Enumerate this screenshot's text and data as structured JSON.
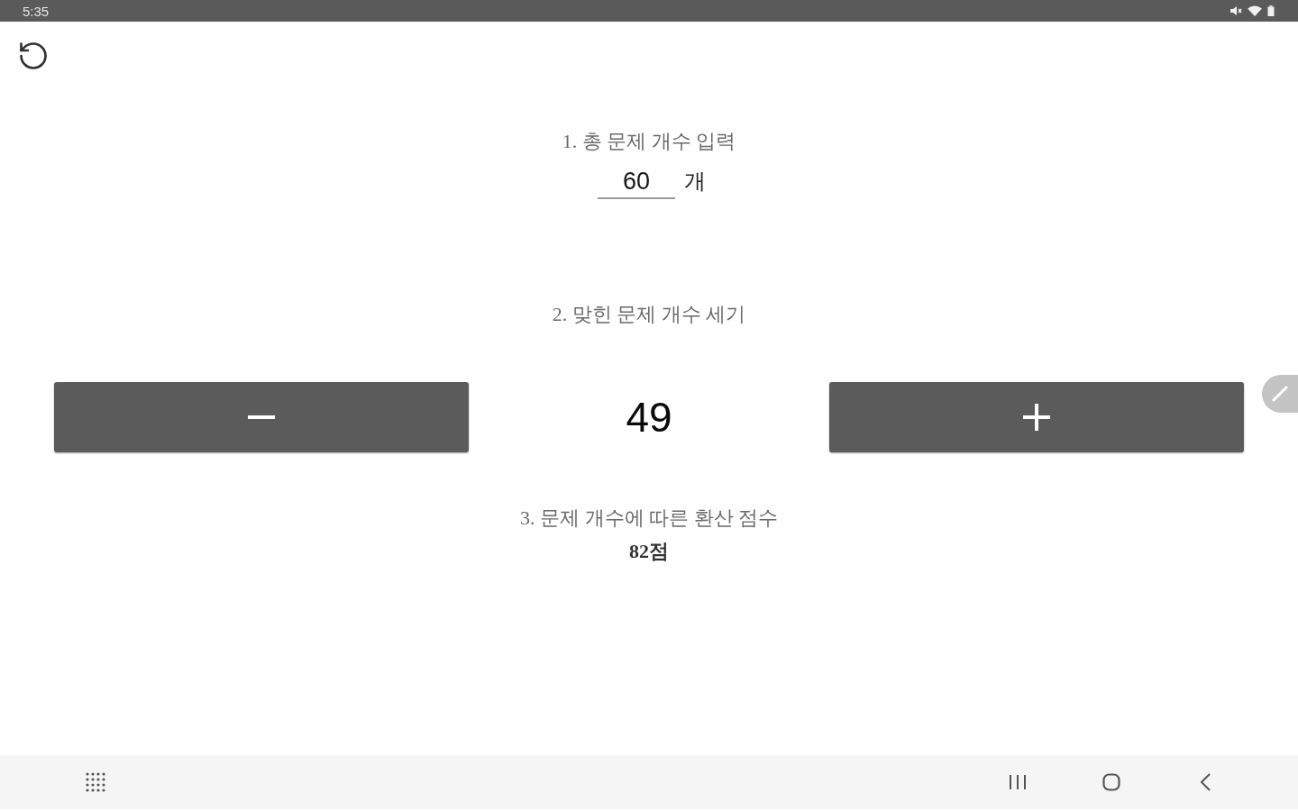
{
  "status_bar": {
    "time": "5:35"
  },
  "total_input": {
    "heading": "1. 총 문제 개수 입력",
    "value": "60",
    "unit": "개"
  },
  "counter": {
    "heading": "2. 맞힌 문제 개수 세기",
    "count": "49"
  },
  "result": {
    "heading": "3. 문제 개수에 따른 환산 점수",
    "score": "82점"
  }
}
